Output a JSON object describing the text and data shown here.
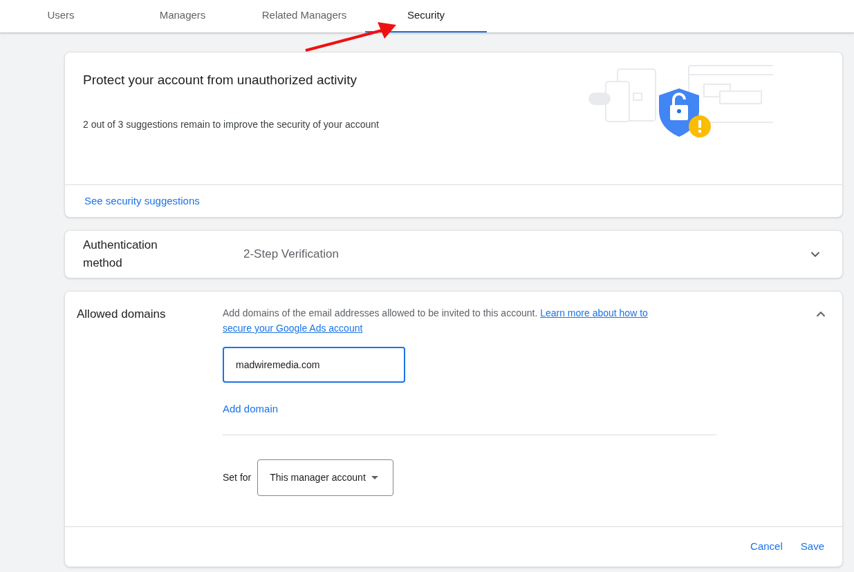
{
  "tabs": [
    {
      "label": "Users",
      "selected": false
    },
    {
      "label": "Managers",
      "selected": false
    },
    {
      "label": "Related Managers",
      "selected": false
    },
    {
      "label": "Security",
      "selected": true
    }
  ],
  "suggestions_card": {
    "title": "Protect your account from unauthorized activity",
    "subtitle": "2 out of 3 suggestions remain to improve the security of your account",
    "link": "See security suggestions"
  },
  "authentication": {
    "label": "Authentication method",
    "value": "2-Step Verification",
    "expanded": false
  },
  "allowed_domains": {
    "label": "Allowed domains",
    "expanded": true,
    "description": "Add domains of the email addresses allowed to be invited to this account.",
    "learn_more_link": [
      "Learn more about how to",
      "secure your Google Ads account"
    ],
    "domain_value": "madwiremedia.com",
    "add_domain": "Add domain",
    "set_for_label": "Set for",
    "set_for_value": "This manager account",
    "buttons": [
      "Cancel",
      "Save"
    ]
  }
}
